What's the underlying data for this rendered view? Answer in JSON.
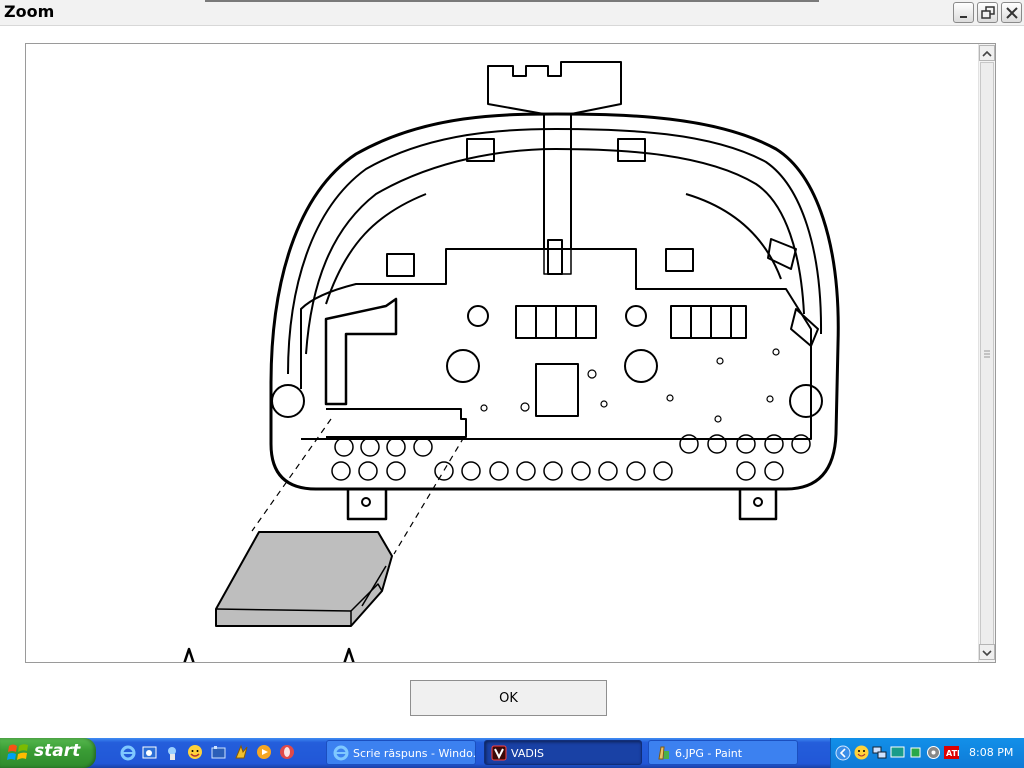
{
  "window": {
    "title": "Zoom",
    "controls": [
      "minimize",
      "restore",
      "close"
    ]
  },
  "dialog": {
    "ok_label": "OK"
  },
  "taskbar": {
    "start_label": "start",
    "tasks": [
      {
        "label": "Scrie răspuns - Windo...",
        "icon": "internet-explorer-icon",
        "active": false
      },
      {
        "label": "VADIS",
        "icon": "vadis-icon",
        "active": true
      },
      {
        "label": "6.JPG - Paint",
        "icon": "paint-icon",
        "active": false
      }
    ],
    "clock": "8:08 PM"
  }
}
